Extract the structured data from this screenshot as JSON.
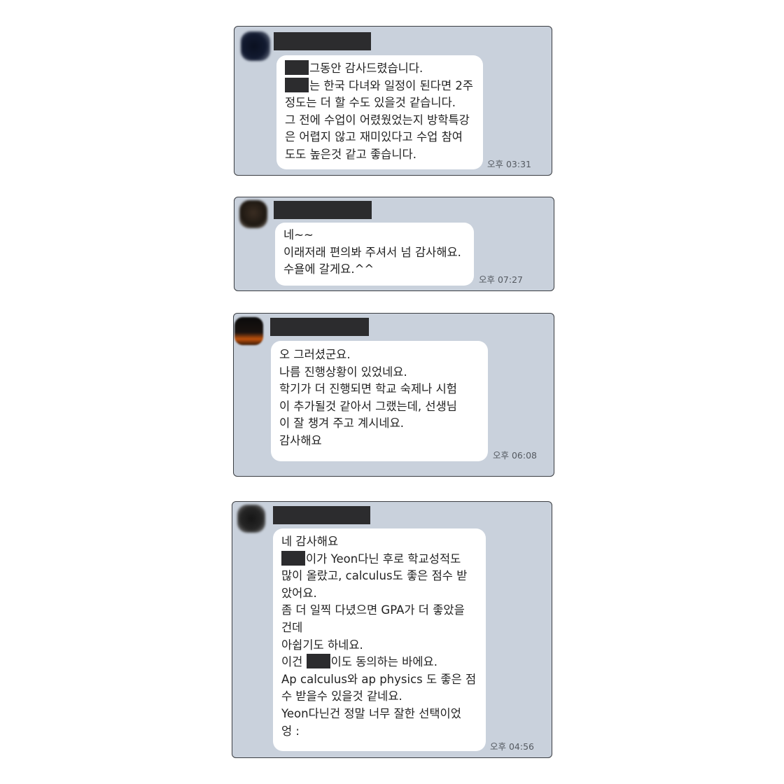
{
  "messages": [
    {
      "sender": "",
      "time": "오후 03:31",
      "lines": [
        {
          "redact": true,
          "text": "그동안 감사드렸습니다."
        },
        {
          "redact": true,
          "text": "는 한국 다녀와 일정이 된다면 2주"
        },
        {
          "redact": false,
          "text": "정도는 더 할 수도 있을것 같습니다."
        },
        {
          "redact": false,
          "text": "그 전에 수업이 어렸웠었는지 방학특강"
        },
        {
          "redact": false,
          "text": "은 어렵지 않고 재미있다고 수업 참여"
        },
        {
          "redact": false,
          "text": "도도 높은것 같고 좋습니다."
        }
      ]
    },
    {
      "sender": "",
      "time": "오후 07:27",
      "lines": [
        {
          "redact": false,
          "text": "네~~"
        },
        {
          "redact": false,
          "text": "이래저래 편의봐 주셔서 넘 감사해요."
        },
        {
          "redact": false,
          "text": "수욜에 갈게요.^^"
        }
      ]
    },
    {
      "sender": "",
      "time": "오후 06:08",
      "lines": [
        {
          "redact": false,
          "text": "오 그러셨군요."
        },
        {
          "redact": false,
          "text": "나름 진행상황이 있었네요."
        },
        {
          "redact": false,
          "text": "학기가 더 진행되면 학교 숙제나 시험"
        },
        {
          "redact": false,
          "text": "이 추가될것 같아서 그랬는데, 선생님"
        },
        {
          "redact": false,
          "text": "이 잘 챙겨 주고 계시네요."
        },
        {
          "redact": false,
          "text": "감사해요"
        }
      ]
    },
    {
      "sender": "",
      "time": "오후 04:56",
      "lines": [
        {
          "redact": false,
          "text": "네 감사해요"
        },
        {
          "redact": true,
          "text": "이가 Yeon다닌 후로 학교성적도"
        },
        {
          "redact": false,
          "text": "많이 올랐고, calculus도 좋은 점수 받"
        },
        {
          "redact": false,
          "text": "았어요."
        },
        {
          "redact": false,
          "text": "좀 더 일찍 다녔으면 GPA가 더 좋았을"
        },
        {
          "redact": false,
          "text": "건데"
        },
        {
          "redact": false,
          "text": "아쉽기도 하네요."
        },
        {
          "redact": true,
          "prefix": "이건 ",
          "text": "이도 동의하는 바에요."
        },
        {
          "redact": false,
          "text": "Ap calculus와 ap physics 도 좋은 점"
        },
        {
          "redact": false,
          "text": "수 받을수 있을것 같네요."
        },
        {
          "redact": false,
          "text": "Yeon다닌건 정말 너무 잘한 선택이었"
        },
        {
          "redact": false,
          "text": "엉 :"
        }
      ]
    }
  ]
}
